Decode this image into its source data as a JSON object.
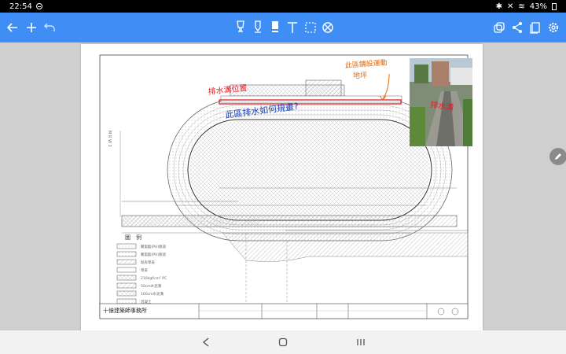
{
  "status_bar": {
    "time": "22:54",
    "battery": "43%"
  },
  "toolbar": {
    "left_icons": [
      "back-arrow-icon",
      "add-icon",
      "undo-icon"
    ],
    "center_icons": [
      "marker-pen-icon",
      "pen-icon",
      "highlighter-icon",
      "text-tool-icon",
      "lasso-select-icon",
      "eraser-icon"
    ],
    "right_icons": [
      "layers-icon",
      "share-icon",
      "page-icon",
      "settings-icon"
    ]
  },
  "drawing": {
    "title_block": "十億建築師事務所",
    "legend_title": "圖　例",
    "legend_items": [
      "聚氨酯(PU)跑道",
      "聚氨酯(PU)跑道",
      "既有草皮",
      "草皮",
      "210kgf/cm² PC",
      "50cm水泥溝",
      "100cm水泥溝",
      "混凝土"
    ],
    "side_label": "M R W 3"
  },
  "annotations": {
    "red_note": "排水溝位置",
    "blue_note": "此區排水如何規畫?",
    "orange_note_line1": "此區鋪設運動",
    "orange_note_line2": "地坪",
    "photo_note": "排水溝"
  },
  "colors": {
    "toolbar": "#3f8ef5",
    "red_ink": "#e0202a",
    "blue_ink": "#1a3aa8",
    "orange_ink": "#e36a10"
  }
}
